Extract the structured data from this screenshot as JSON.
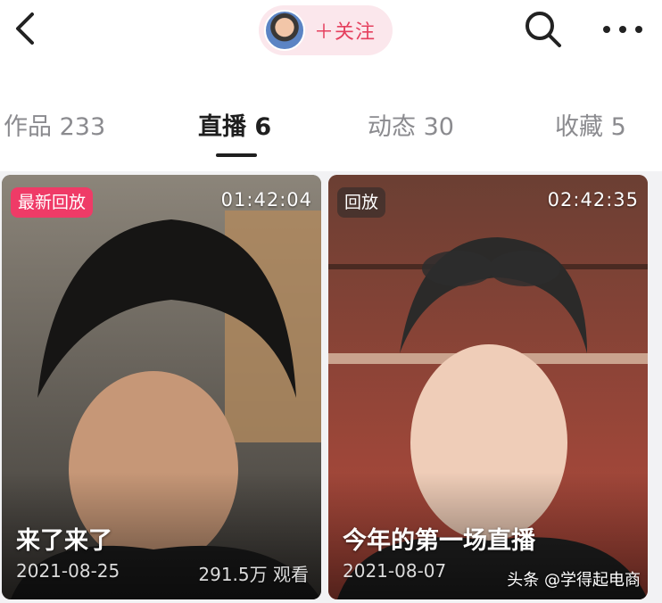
{
  "header": {
    "follow_label": "＋关注"
  },
  "tabs": [
    {
      "label": "作品 233"
    },
    {
      "label": "直播 6"
    },
    {
      "label": "动态 30"
    },
    {
      "label": "收藏 5"
    }
  ],
  "active_tab_index": 1,
  "cards": [
    {
      "badge": "最新回放",
      "duration": "01:42:04",
      "title": "来了来了",
      "date": "2021-08-25",
      "views": "291.5万 观看"
    },
    {
      "badge": "回放",
      "duration": "02:42:35",
      "title": "今年的第一场直播",
      "date": "2021-08-07",
      "views": ""
    }
  ],
  "watermark": "头条 @学得起电商",
  "colors": {
    "accent": "#ef3b67",
    "follow_bg": "#fbe7ec",
    "follow_text": "#e5405e"
  },
  "icons": [
    "back-icon",
    "search-icon",
    "more-icon",
    "avatar"
  ]
}
